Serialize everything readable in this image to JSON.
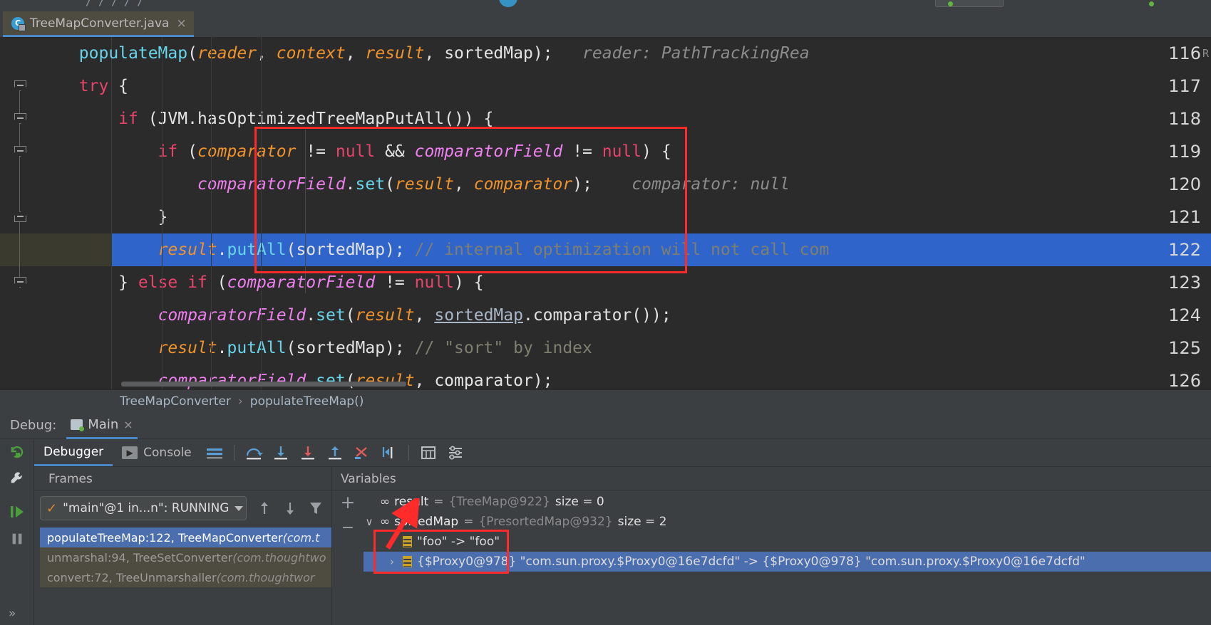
{
  "window": {
    "tab": {
      "title": "TreeMapConverter.java",
      "icon": "java-class-icon",
      "close": "×"
    }
  },
  "editor": {
    "lines": [
      {
        "number": "116",
        "fold": "none",
        "tokens": [
          {
            "t": "        ",
            "c": "pun"
          },
          {
            "t": "populateMap",
            "c": "mth"
          },
          {
            "t": "(",
            "c": "pun"
          },
          {
            "t": "reader",
            "c": "par"
          },
          {
            "t": ", ",
            "c": "pun"
          },
          {
            "t": "context",
            "c": "par"
          },
          {
            "t": ", ",
            "c": "pun"
          },
          {
            "t": "result",
            "c": "par"
          },
          {
            "t": ", sortedMap);",
            "c": "pun"
          },
          {
            "t": "   reader: PathTrackingRea",
            "c": "hint"
          }
        ]
      },
      {
        "number": "117",
        "fold": "down",
        "tokens": [
          {
            "t": "        ",
            "c": "pun"
          },
          {
            "t": "try",
            "c": "kw"
          },
          {
            "t": " {",
            "c": "pun"
          }
        ]
      },
      {
        "number": "118",
        "fold": "down",
        "tokens": [
          {
            "t": "            ",
            "c": "pun"
          },
          {
            "t": "if",
            "c": "kw"
          },
          {
            "t": " (JVM.",
            "c": "pun"
          },
          {
            "t": "hasOptimizedTreeMapPutAll",
            "c": "cls"
          },
          {
            "t": "()) {",
            "c": "pun"
          }
        ]
      },
      {
        "number": "119",
        "fold": "down",
        "tokens": [
          {
            "t": "                ",
            "c": "pun"
          },
          {
            "t": "if",
            "c": "kw"
          },
          {
            "t": " (",
            "c": "pun"
          },
          {
            "t": "comparator",
            "c": "par"
          },
          {
            "t": " != ",
            "c": "pun"
          },
          {
            "t": "null",
            "c": "kw"
          },
          {
            "t": " && ",
            "c": "pun"
          },
          {
            "t": "comparatorField",
            "c": "fld"
          },
          {
            "t": " != ",
            "c": "pun"
          },
          {
            "t": "null",
            "c": "kw"
          },
          {
            "t": ") {",
            "c": "pun"
          }
        ]
      },
      {
        "number": "120",
        "fold": "none",
        "tokens": [
          {
            "t": "                    ",
            "c": "pun"
          },
          {
            "t": "comparatorField",
            "c": "fld"
          },
          {
            "t": ".",
            "c": "pun"
          },
          {
            "t": "set",
            "c": "mth"
          },
          {
            "t": "(",
            "c": "pun"
          },
          {
            "t": "result",
            "c": "par"
          },
          {
            "t": ", ",
            "c": "pun"
          },
          {
            "t": "comparator",
            "c": "par"
          },
          {
            "t": ");",
            "c": "pun"
          },
          {
            "t": "    comparator: null",
            "c": "hint"
          }
        ]
      },
      {
        "number": "121",
        "fold": "up",
        "tokens": [
          {
            "t": "                ",
            "c": "pun"
          },
          {
            "t": "}",
            "c": "pun"
          }
        ]
      },
      {
        "number": "122",
        "fold": "none",
        "executing": true,
        "tokens": [
          {
            "t": "                ",
            "c": "pun"
          },
          {
            "t": "result",
            "c": "par"
          },
          {
            "t": ".",
            "c": "pun"
          },
          {
            "t": "putAll",
            "c": "mth"
          },
          {
            "t": "(sortedMap); ",
            "c": "pun"
          },
          {
            "t": "// internal optimization will not call com",
            "c": "cmt"
          }
        ]
      },
      {
        "number": "123",
        "fold": "down",
        "tokens": [
          {
            "t": "            ",
            "c": "pun"
          },
          {
            "t": "} ",
            "c": "pun"
          },
          {
            "t": "else if",
            "c": "kw"
          },
          {
            "t": " (",
            "c": "pun"
          },
          {
            "t": "comparatorField",
            "c": "fld"
          },
          {
            "t": " != ",
            "c": "pun"
          },
          {
            "t": "null",
            "c": "kw"
          },
          {
            "t": ") {",
            "c": "pun"
          }
        ]
      },
      {
        "number": "124",
        "fold": "none",
        "tokens": [
          {
            "t": "                ",
            "c": "pun"
          },
          {
            "t": "comparatorField",
            "c": "fld"
          },
          {
            "t": ".",
            "c": "pun"
          },
          {
            "t": "set",
            "c": "mth"
          },
          {
            "t": "(",
            "c": "pun"
          },
          {
            "t": "result",
            "c": "par"
          },
          {
            "t": ", ",
            "c": "pun"
          },
          {
            "t": "sortedMap",
            "c": "lnk"
          },
          {
            "t": ".comparator());",
            "c": "pun"
          }
        ]
      },
      {
        "number": "125",
        "fold": "none",
        "tokens": [
          {
            "t": "                ",
            "c": "pun"
          },
          {
            "t": "result",
            "c": "par"
          },
          {
            "t": ".",
            "c": "pun"
          },
          {
            "t": "putAll",
            "c": "mth"
          },
          {
            "t": "(sortedMap); ",
            "c": "pun"
          },
          {
            "t": "// \"sort\" by index",
            "c": "cmt"
          }
        ]
      },
      {
        "number": "126",
        "fold": "none",
        "tokens": [
          {
            "t": "                ",
            "c": "pun"
          },
          {
            "t": "comparatorField",
            "c": "fld"
          },
          {
            "t": ".",
            "c": "pun"
          },
          {
            "t": "set",
            "c": "mth"
          },
          {
            "t": "(",
            "c": "pun"
          },
          {
            "t": "result",
            "c": "par"
          },
          {
            "t": ", comparator);",
            "c": "pun"
          }
        ]
      }
    ],
    "right_edge_char": "R"
  },
  "breadcrumb": {
    "class": "TreeMapConverter",
    "separator": "›",
    "method": "populateTreeMap()"
  },
  "debug": {
    "label": "Debug:",
    "session_tab": "Main",
    "session_close": "×",
    "tabs": [
      {
        "label": "Debugger",
        "icon": "debugger-icon",
        "active": true
      },
      {
        "label": "Console",
        "icon": "console-icon",
        "active": false
      }
    ],
    "toolbar_icons": [
      "layout-lines-icon",
      "step-over-icon",
      "step-into-icon",
      "force-step-into-icon",
      "step-out-icon",
      "drop-frame-icon",
      "run-to-cursor-icon",
      "evaluate-expression-icon",
      "settings-icon"
    ],
    "rail_icons": [
      "rerun-icon",
      "settings-wrench-icon",
      "resume-icon",
      "pause-icon",
      "expand-rail-icon"
    ],
    "frames": {
      "header": "Frames",
      "thread": "\"main\"@1 in...n\": RUNNING",
      "thread_status_icon": "check-icon",
      "nav_icons": [
        "arrow-up-icon",
        "arrow-down-icon",
        "filter-icon"
      ],
      "rows": [
        {
          "text": "populateTreeMap:122, TreeMapConverter ",
          "pkg": "(com.t",
          "state": "selected"
        },
        {
          "text": "unmarshal:94, TreeSetConverter ",
          "pkg": "(com.thoughtwo",
          "state": "alt"
        },
        {
          "text": "convert:72, TreeUnmarshaller ",
          "pkg": "(com.thoughtwor",
          "state": "alt"
        }
      ]
    },
    "variables": {
      "header": "Variables",
      "add_button": "+",
      "remove_button": "−",
      "rows": [
        {
          "indent": 0,
          "chevron": "",
          "icon": "infinity-icon",
          "name": "result",
          "eq": " = ",
          "type": "{TreeMap@922}",
          "size": "size = 0",
          "selected": false
        },
        {
          "indent": 0,
          "chevron": "∨",
          "icon": "infinity-icon",
          "name": "sortedMap",
          "eq": " = ",
          "type": "{PresortedMap@932}",
          "size": "size = 2",
          "selected": false
        },
        {
          "indent": 1,
          "chevron": "›",
          "icon": "map-entry-icon",
          "value": "\"foo\" -> \"foo\"",
          "selected": false
        },
        {
          "indent": 1,
          "chevron": "›",
          "icon": "map-entry-icon",
          "value": "{$Proxy0@978} \"com.sun.proxy.$Proxy0@16e7dcfd\" -> {$Proxy0@978} \"com.sun.proxy.$Proxy0@16e7dcfd\"",
          "selected": true
        }
      ]
    }
  },
  "annotations": {
    "code_rect": "red-rectangle-code",
    "vars_rect": "red-rectangle-variables",
    "arrow": "red-arrow-to-result"
  },
  "colors": {
    "accent_blue": "#4a88c7",
    "selection_blue": "#4b6eaf",
    "exec_line": "#2f65ca",
    "annotation_red": "#ff2b2b",
    "editor_bg": "#2b2b2b",
    "panel_bg": "#3c3f41"
  }
}
